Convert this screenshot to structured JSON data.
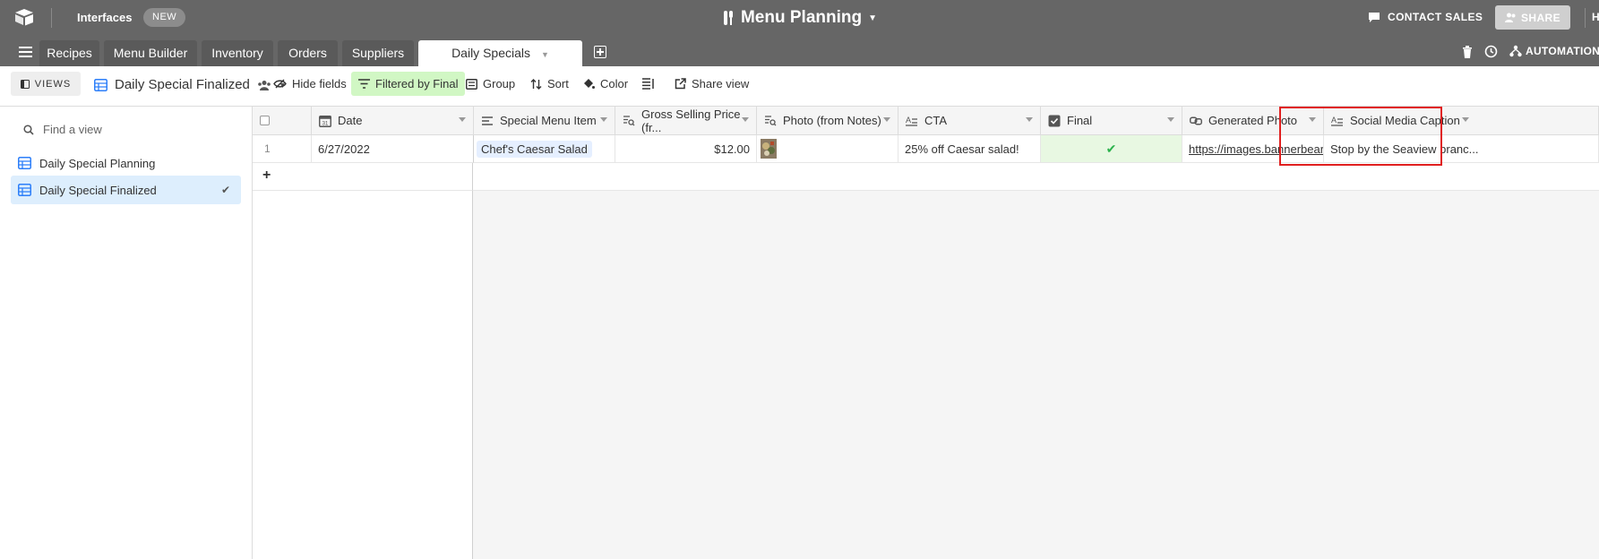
{
  "topbar": {
    "interfaces_label": "Interfaces",
    "new_badge": "NEW",
    "base_title": "Menu Planning",
    "contact_sales": "CONTACT SALES",
    "share": "SHARE",
    "help_partial": "H"
  },
  "tabs": {
    "items": [
      {
        "label": "Recipes"
      },
      {
        "label": "Menu Builder"
      },
      {
        "label": "Inventory"
      },
      {
        "label": "Orders"
      },
      {
        "label": "Suppliers"
      },
      {
        "label": "Daily Specials"
      }
    ],
    "active_index": 5,
    "right_automations": "AUTOMATION"
  },
  "toolbar": {
    "views_label": "VIEWS",
    "view_name": "Daily Special Finalized",
    "hide_fields": "Hide fields",
    "filter": "Filtered by Final",
    "group": "Group",
    "sort": "Sort",
    "color": "Color",
    "share_view": "Share view"
  },
  "sidebar": {
    "find_placeholder": "Find a view",
    "views": [
      {
        "label": "Daily Special Planning",
        "active": false
      },
      {
        "label": "Daily Special Finalized",
        "active": true
      }
    ]
  },
  "grid": {
    "columns": [
      {
        "label": "Date",
        "icon": "calendar-icon"
      },
      {
        "label": "Special Menu Item",
        "icon": "link-record-icon"
      },
      {
        "label": "Gross Selling Price (fr...",
        "icon": "lookup-icon"
      },
      {
        "label": "Photo (from Notes)",
        "icon": "lookup-icon"
      },
      {
        "label": "CTA",
        "icon": "text-icon"
      },
      {
        "label": "Final",
        "icon": "checkbox-icon"
      },
      {
        "label": "Generated Photo",
        "icon": "url-icon"
      },
      {
        "label": "Social Media Caption",
        "icon": "text-icon"
      }
    ],
    "rows": [
      {
        "number": "1",
        "date": "6/27/2022",
        "menu_item": "Chef's Caesar Salad",
        "price": "$12.00",
        "cta": "25% off Caesar salad!",
        "final": true,
        "generated_photo": "https://images.bannerbear....",
        "caption": "Stop by the Seaview branc..."
      }
    ]
  },
  "colors": {
    "topbar": "#666666",
    "filter_bg": "#d1f7c4",
    "active_view_bg": "#ddeefd",
    "final_cell_bg": "#e8f8e2",
    "highlight": "#e02020",
    "check_green": "#2bb24c"
  }
}
